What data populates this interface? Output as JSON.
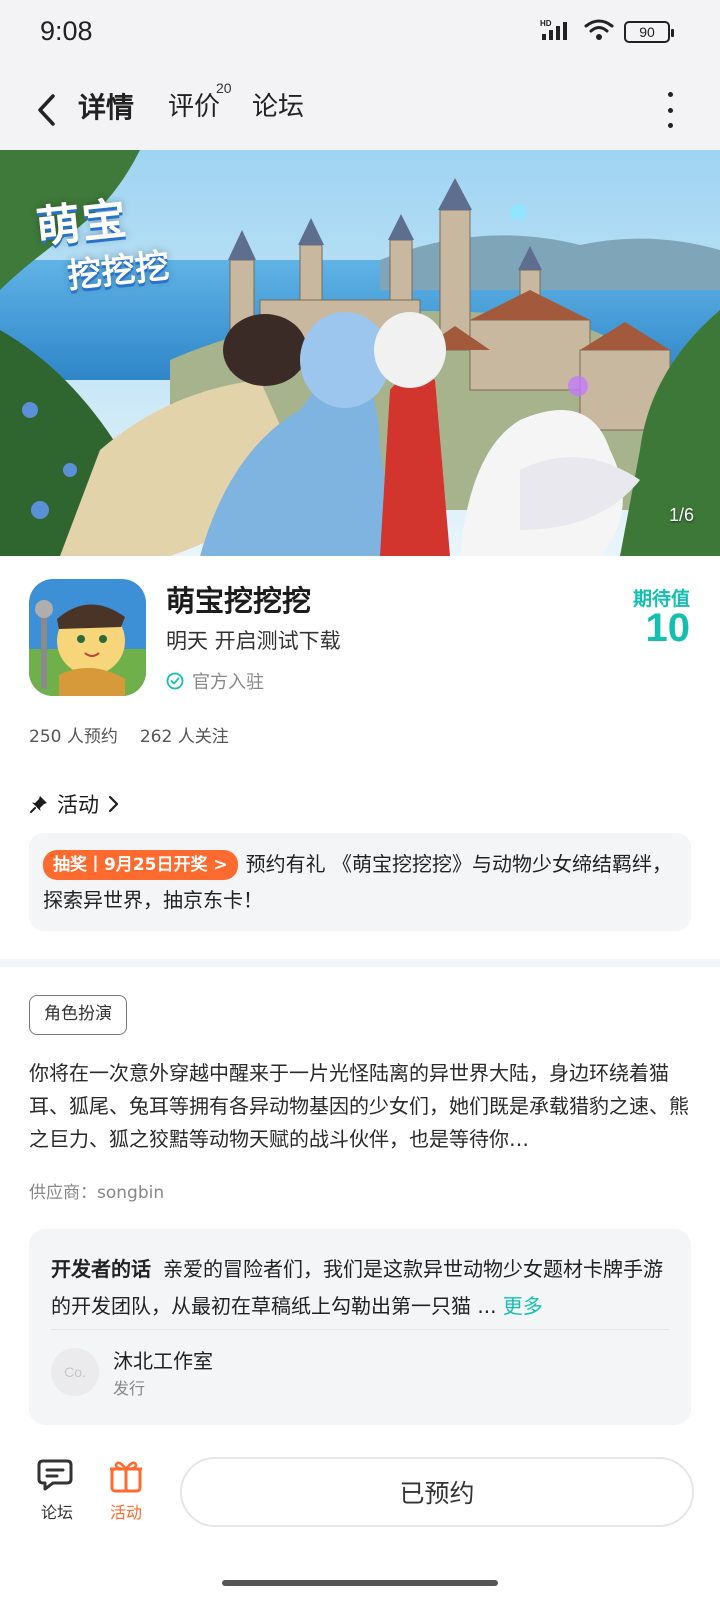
{
  "status_bar": {
    "time": "9:08",
    "hd": "HD",
    "battery": "90"
  },
  "header": {
    "tabs": [
      {
        "label": "详情",
        "badge": ""
      },
      {
        "label": "评价",
        "badge": "20"
      },
      {
        "label": "论坛",
        "badge": ""
      }
    ]
  },
  "banner": {
    "logo_line1": "萌宝",
    "logo_line2": "挖挖挖",
    "counter": "1/6"
  },
  "game": {
    "title": "萌宝挖挖挖",
    "status": "明天 开启测试下载",
    "official": "官方入驻",
    "expect_label": "期待值",
    "expect_value": "10",
    "reservations": "250 人预约",
    "followers": "262 人关注"
  },
  "activity": {
    "heading": "活动",
    "badge": "抽奖丨9月25日开奖 >",
    "text": "预约有礼 《萌宝挖挖挖》与动物少女缔结羁绊，探索异世界，抽京东卡！"
  },
  "description": {
    "tag": "角色扮演",
    "text": "你将在一次意外穿越中醒来于一片光怪陆离的异世界大陆，身边环绕着猫耳、狐尾、兔耳等拥有各异动物基因的少女们，她们既是承载猎豹之速、熊之巨力、狐之狡黠等动物天赋的战斗伙伴，也是等待你…",
    "supplier": "供应商：songbin"
  },
  "developer": {
    "label": "开发者的话",
    "text": "亲爱的冒险者们，我们是这款异世动物少女题材卡牌手游的开发团队，从最初在草稿纸上勾勒出第一只猫 ...",
    "more": "更多",
    "avatar_text": "Co.",
    "studio_name": "沐北工作室",
    "studio_role": "发行"
  },
  "bottom_bar": {
    "forum_label": "论坛",
    "activity_label": "活动",
    "reserve_label": "已预约"
  },
  "colors": {
    "accent": "#14bfb0",
    "orange": "#ff6a2f"
  }
}
